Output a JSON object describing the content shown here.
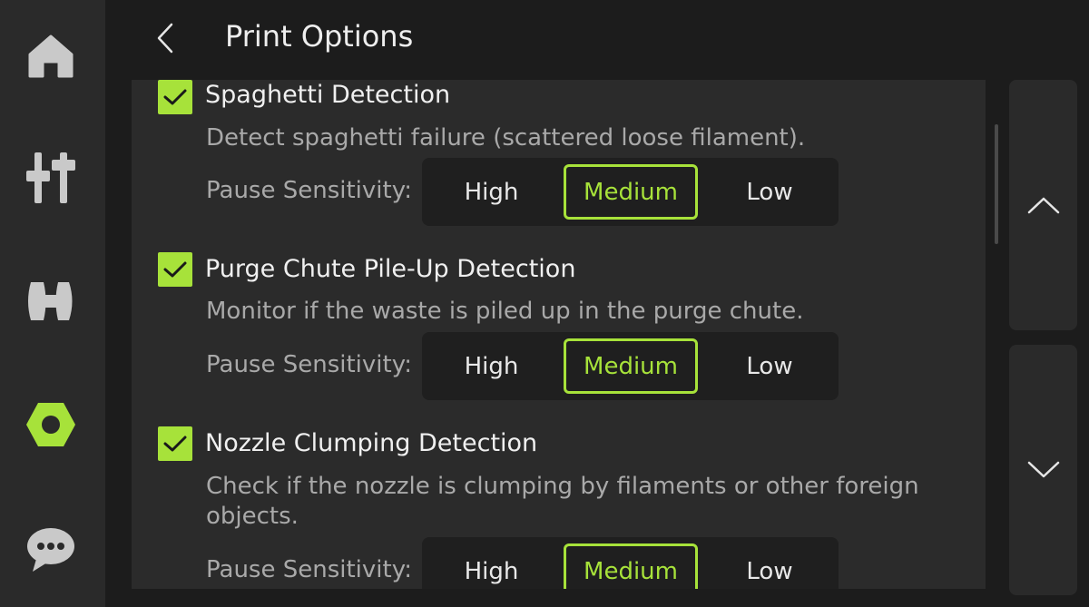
{
  "header": {
    "title": "Print Options",
    "back_icon": "chevron-left-icon"
  },
  "sidebar": {
    "items": [
      {
        "name": "home",
        "icon": "home-icon",
        "active": false
      },
      {
        "name": "control",
        "icon": "sliders-icon",
        "active": false
      },
      {
        "name": "filament",
        "icon": "filament-spool-icon",
        "active": false
      },
      {
        "name": "settings",
        "icon": "hex-nut-icon",
        "active": true
      },
      {
        "name": "messages",
        "icon": "chat-bubble-icon",
        "active": false
      }
    ]
  },
  "options": [
    {
      "checked": true,
      "title": "Spaghetti Detection",
      "description": "Detect spaghetti failure (scattered loose filament).",
      "sensitivity_label": "Pause Sensitivity:",
      "levels": [
        "High",
        "Medium",
        "Low"
      ],
      "selected": "Medium"
    },
    {
      "checked": true,
      "title": "Purge Chute Pile-Up Detection",
      "description": "Monitor if the waste is piled up in the purge chute.",
      "sensitivity_label": "Pause Sensitivity:",
      "levels": [
        "High",
        "Medium",
        "Low"
      ],
      "selected": "Medium"
    },
    {
      "checked": true,
      "title": "Nozzle Clumping Detection",
      "description": "Check if the nozzle is clumping by filaments or other foreign objects.",
      "sensitivity_label": "Pause Sensitivity:",
      "levels": [
        "High",
        "Medium",
        "Low"
      ],
      "selected": "Medium"
    }
  ],
  "scroll": {
    "up_icon": "chevron-up-icon",
    "down_icon": "chevron-down-icon"
  },
  "colors": {
    "accent": "#a7e23a",
    "background": "#1c1c1c",
    "panel": "#2b2b2b"
  }
}
